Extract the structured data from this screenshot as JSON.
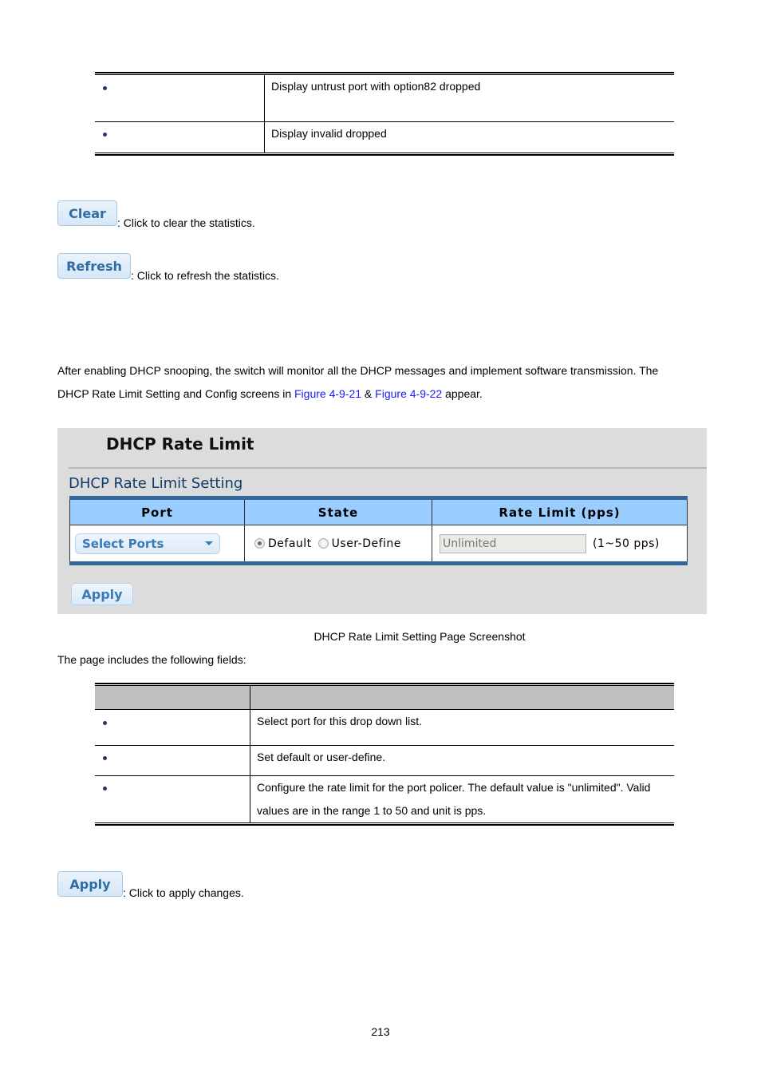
{
  "table1": {
    "rows": [
      {
        "desc": "Display untrust port with option82 dropped"
      },
      {
        "desc": "Display invalid dropped"
      }
    ]
  },
  "buttons": {
    "clear": {
      "label": "Clear",
      "caption": ": Click to clear the statistics."
    },
    "refresh": {
      "label": "Refresh",
      "caption": ": Click to refresh the statistics."
    },
    "apply": {
      "label": "Apply",
      "caption": ": Click to apply changes."
    }
  },
  "intro": {
    "line1": "After enabling DHCP snooping, the switch will monitor all the DHCP messages and implement software transmission. The",
    "line2_pre": "DHCP Rate Limit Setting and Config screens in ",
    "link1": "Figure 4-9-21",
    "amp": " & ",
    "link2": "Figure 4-9-22",
    "line2_post": " appear."
  },
  "screenshot": {
    "title": "DHCP Rate Limit",
    "subtitle": "DHCP Rate Limit Setting",
    "columns": [
      "Port",
      "State",
      "Rate Limit (pps)"
    ],
    "port_select": "Select Ports",
    "state_options": [
      {
        "label": "Default",
        "checked": true
      },
      {
        "label": "User-Define",
        "checked": false
      }
    ],
    "rate_value": "Unlimited",
    "rate_range": "(1~50 pps)",
    "apply_label": "Apply"
  },
  "caption": "DHCP Rate Limit Setting Page Screenshot",
  "fields_intro": "The page includes the following fields:",
  "table2": {
    "rows": [
      {
        "desc": [
          "Select port for this drop down list."
        ]
      },
      {
        "desc": [
          "Set default or user-define."
        ]
      },
      {
        "desc": [
          "Configure the rate limit for the port policer. The default value is \"unlimited\". Valid",
          "values are in the range 1 to 50 and unit is pps."
        ]
      }
    ]
  },
  "page_number": "213"
}
